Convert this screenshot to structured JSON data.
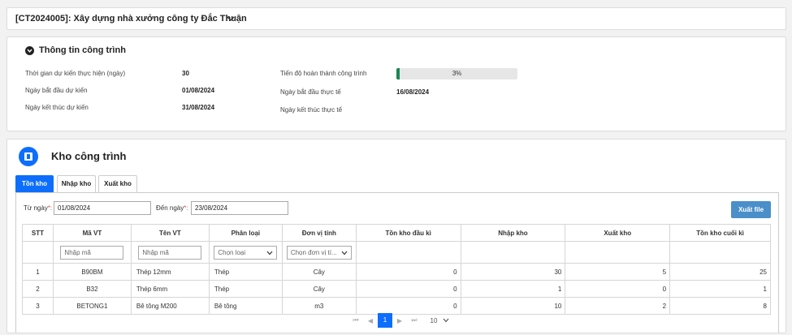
{
  "project": {
    "title": "[CT2024005]: Xây dựng nhà xưởng công ty Đắc Thuận"
  },
  "info": {
    "header": "Thông tin công trình",
    "planned_days_label": "Thời gian dự kiến thực hiện (ngày)",
    "planned_days_value": "30",
    "planned_start_label": "Ngày bắt đầu dự kiến",
    "planned_start_value": "01/08/2024",
    "planned_end_label": "Ngày kết thúc dự kiến",
    "planned_end_value": "31/08/2024",
    "progress_label": "Tiến độ hoàn thành công trình",
    "progress_text": "3%",
    "progress_fraction": 0.03,
    "actual_start_label": "Ngày bắt đầu thực tế",
    "actual_start_value": "16/08/2024",
    "actual_end_label": "Ngày kết thúc thực tế",
    "actual_end_value": ""
  },
  "warehouse": {
    "title": "Kho công trình",
    "tabs": [
      {
        "label": "Tồn kho",
        "active": true
      },
      {
        "label": "Nhập kho",
        "active": false
      },
      {
        "label": "Xuất kho",
        "active": false
      }
    ],
    "filters": {
      "from_label": "Từ ngày",
      "from_value": "01/08/2024",
      "to_label": "Đến ngày",
      "to_value": "23/08/2024",
      "required_mark": "*:"
    },
    "export_label": "Xuất file",
    "columns": [
      "STT",
      "Mã VT",
      "Tên VT",
      "Phân loại",
      "Đơn vị tính",
      "Tồn kho đầu kì",
      "Nhập kho",
      "Xuất kho",
      "Tồn kho cuối kì"
    ],
    "column_filters": {
      "code_placeholder": "Nhập mã",
      "name_placeholder": "Nhập mã",
      "category_placeholder": "Chọn loại",
      "unit_placeholder": "Chọn đơn vị tí..."
    },
    "rows": [
      {
        "stt": "1",
        "code": "B90BM",
        "name": "Thép 12mm",
        "category": "Thép",
        "unit": "Cây",
        "opening": "0",
        "imported": "30",
        "exported": "5",
        "closing": "25"
      },
      {
        "stt": "2",
        "code": "B32",
        "name": "Thép 6mm",
        "category": "Thép",
        "unit": "Cây",
        "opening": "0",
        "imported": "1",
        "exported": "0",
        "closing": "1"
      },
      {
        "stt": "3",
        "code": "BETONG1",
        "name": "Bê tông M200",
        "category": "Bê tông",
        "unit": "m3",
        "opening": "0",
        "imported": "10",
        "exported": "2",
        "closing": "8"
      }
    ],
    "pagination": {
      "current_page": "1",
      "page_size": "10"
    }
  },
  "colors": {
    "primary": "#0d6efd",
    "progress": "#198754",
    "export_button": "#4a8fc9",
    "required": "#d9534f"
  }
}
